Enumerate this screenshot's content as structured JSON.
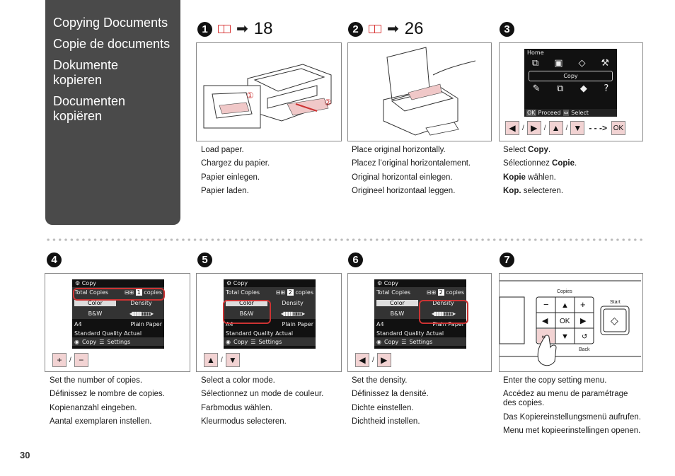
{
  "sidebar": {
    "titles": [
      "Copying Documents",
      "Copie de documents",
      "Dokumente kopieren",
      "Documenten kopiëren"
    ]
  },
  "steps": [
    {
      "num": "1",
      "ref": "18",
      "has_ref": true,
      "lines": [
        "Load paper.",
        "Chargez du papier.",
        "Papier einlegen.",
        "Papier laden."
      ],
      "callouts": [
        "①",
        "②"
      ]
    },
    {
      "num": "2",
      "ref": "26",
      "has_ref": true,
      "lines": [
        "Place original horizontally.",
        "Placez l’original horizontalement.",
        "Original horizontal einlegen.",
        "Origineel horizontaal leggen."
      ]
    },
    {
      "num": "3",
      "lines_rich": [
        {
          "pre": "Select ",
          "bold": "Copy",
          "post": "."
        },
        {
          "pre": "Sélectionnez ",
          "bold": "Copie",
          "post": "."
        },
        {
          "pre": "",
          "bold": "Kopie",
          "post": " wählen."
        },
        {
          "pre": "",
          "bold": "Kop.",
          "post": " selecteren."
        }
      ],
      "lcd": {
        "title": "Home",
        "selected": "Copy",
        "footer_ok": "OK",
        "footer_proceed": "Proceed",
        "footer_select": "Select"
      },
      "buttons": [
        "◀",
        "▶",
        "▲",
        "▼"
      ],
      "arrow": "- - ->",
      "ok": "OK"
    },
    {
      "num": "4",
      "lines": [
        "Set the number of copies.",
        "Définissez le nombre de copies.",
        "Kopienanzahl eingeben.",
        "Aantal exemplaren instellen."
      ],
      "lcd": {
        "title": "Copy",
        "total_label": "Total Copies",
        "count": "1",
        "copies": "copies",
        "color": "Color",
        "bw": "B&W",
        "density": "Density",
        "paper": "A4",
        "type": "Plain Paper",
        "quality": "Standard Quality Actual",
        "foot_copy": "Copy",
        "foot_settings": "Settings"
      },
      "buttons": [
        "+",
        "−"
      ]
    },
    {
      "num": "5",
      "lines": [
        "Select a color mode.",
        "Sélectionnez un mode de couleur.",
        "Farbmodus wählen.",
        "Kleurmodus selecteren."
      ],
      "lcd": {
        "title": "Copy",
        "total_label": "Total Copies",
        "count": "2",
        "copies": "copies",
        "color": "Color",
        "bw": "B&W",
        "density": "Density",
        "paper": "A4",
        "type": "Plain Paper",
        "quality": "Standard Quality Actual",
        "foot_copy": "Copy",
        "foot_settings": "Settings"
      },
      "buttons": [
        "▲",
        "▼"
      ]
    },
    {
      "num": "6",
      "lines": [
        "Set the density.",
        "Définissez la densité.",
        "Dichte einstellen.",
        "Dichtheid instellen."
      ],
      "lcd": {
        "title": "Copy",
        "total_label": "Total Copies",
        "count": "2",
        "copies": "copies",
        "color": "Color",
        "bw": "B&W",
        "density": "Density",
        "paper": "A4",
        "type": "Plain Paper",
        "quality": "Standard Quality Actual",
        "foot_copy": "Copy",
        "foot_settings": "Settings"
      },
      "buttons": [
        "◀",
        "▶"
      ]
    },
    {
      "num": "7",
      "lines": [
        "Enter the copy setting menu.",
        "Accédez au menu de paramétrage des copies.",
        "Das Kopiereinstellungsmenü aufrufen.",
        "Menu met kopieerinstellingen openen."
      ],
      "panel": {
        "copies": "Copies",
        "start": "Start",
        "menu": "Menu",
        "back": "Back",
        "ok": "OK"
      }
    }
  ],
  "page_number": "30",
  "colors": {
    "sidebar": "#4a4a4a",
    "button_fill": "#f2d3d3",
    "highlight": "#cc3333"
  }
}
